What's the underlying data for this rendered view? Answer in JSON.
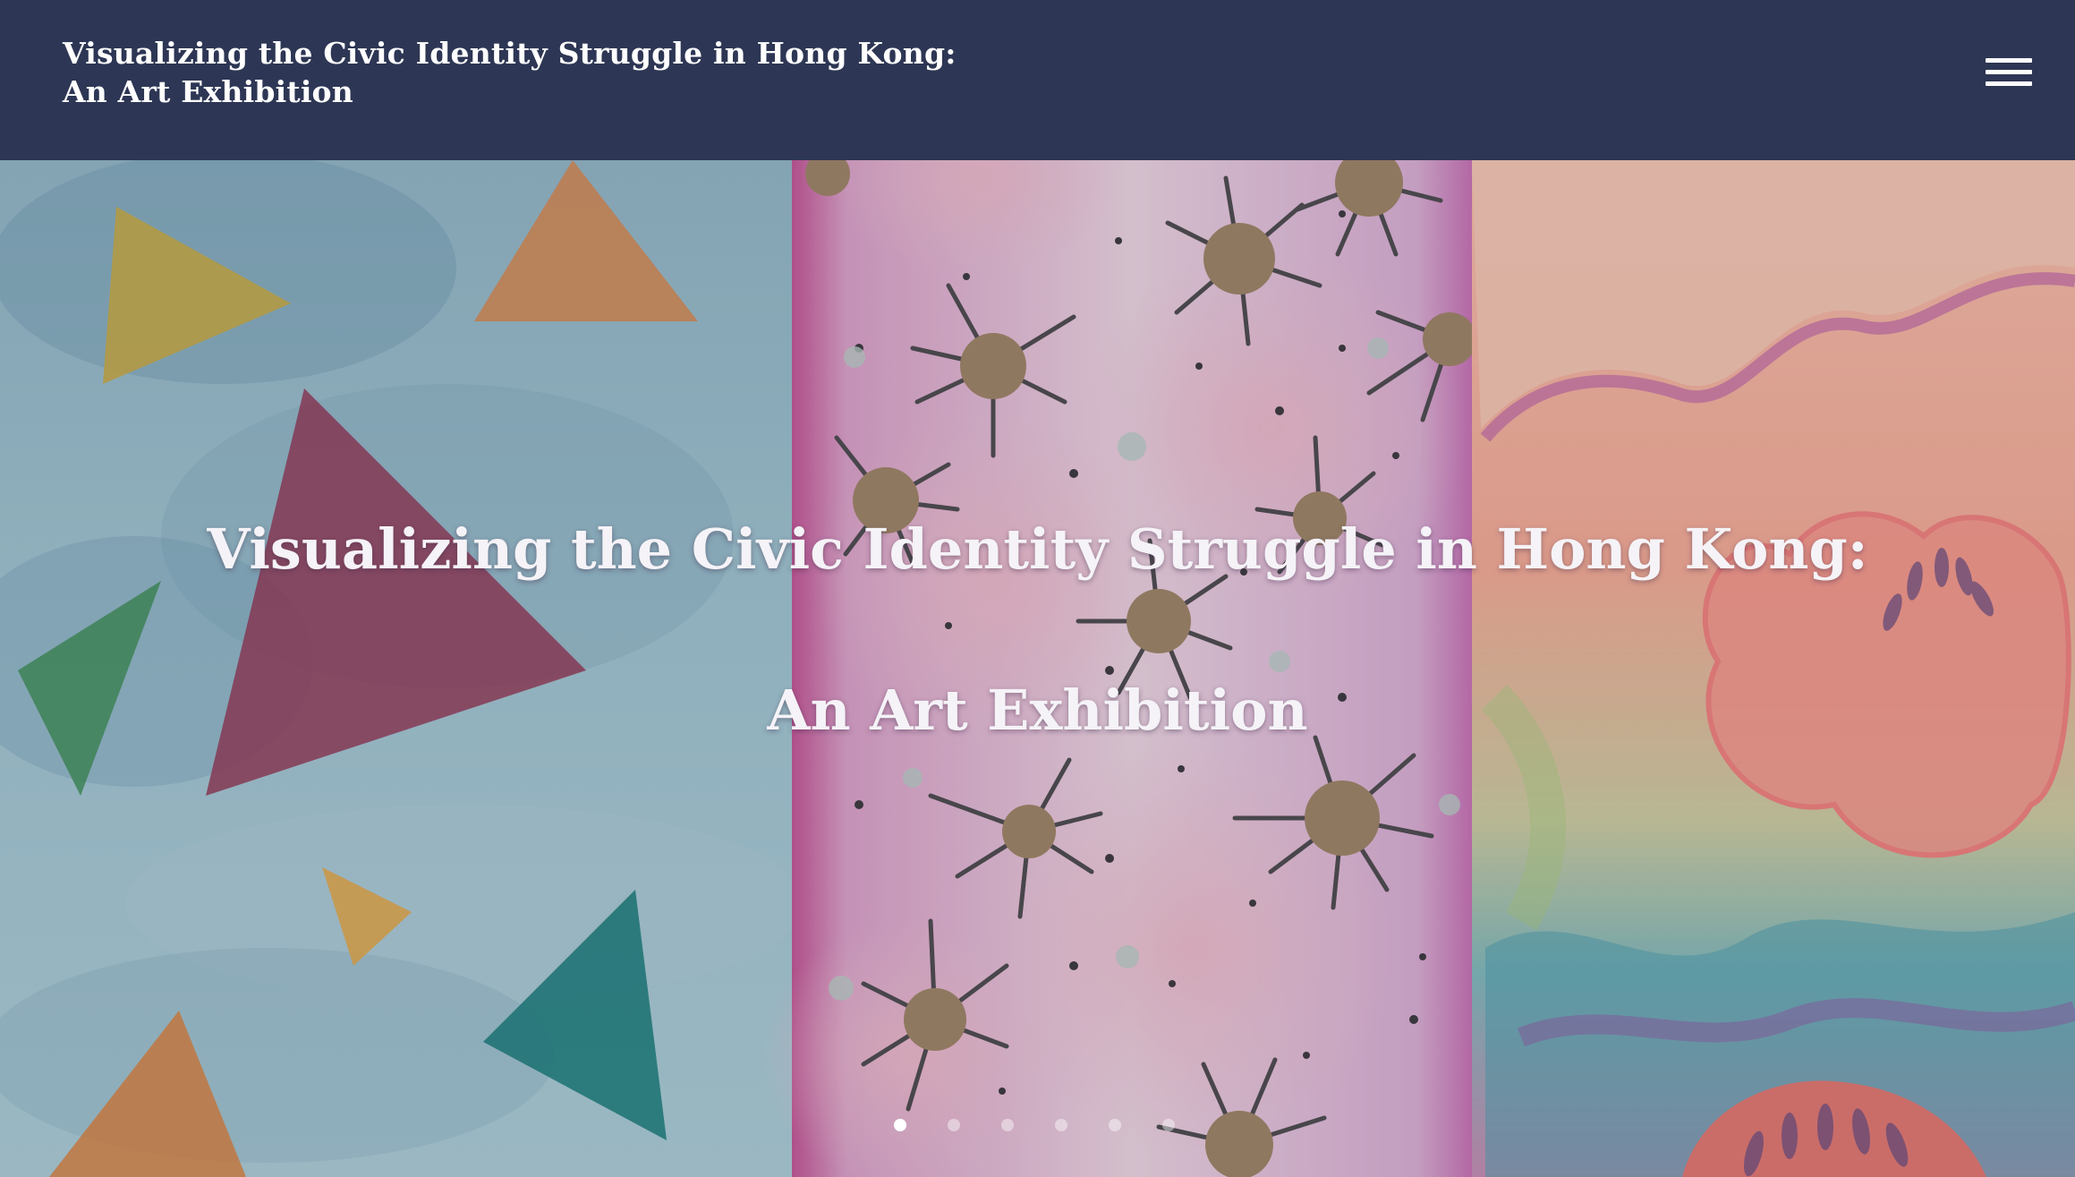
{
  "header": {
    "title_line1": "Visualizing the Civic Identity Struggle in Hong Kong:",
    "title_line2": "An Art Exhibition",
    "menu_icon": "hamburger-menu-icon"
  },
  "hero": {
    "title_line1": "Visualizing the Civic Identity Struggle in Hong Kong:",
    "title_line2": "An Art Exhibition",
    "slides_count": 6,
    "active_slide": 1
  },
  "colors": {
    "header_bg": "#2d3654",
    "text": "#ffffff"
  }
}
